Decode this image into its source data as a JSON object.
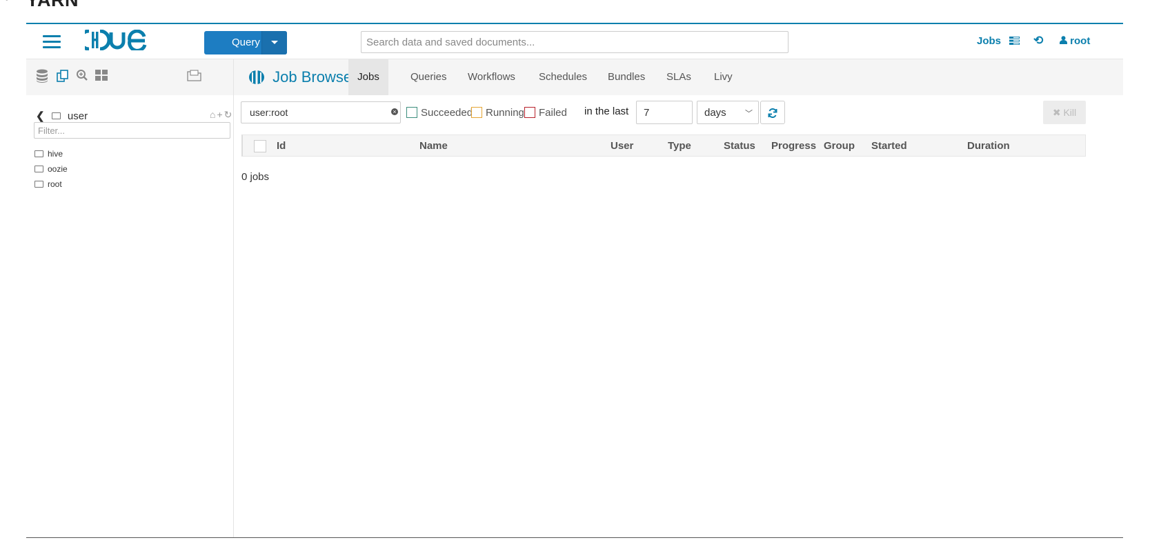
{
  "heading": {
    "bullet": "◦",
    "title": "YARN"
  },
  "topnav": {
    "query_label": "Query",
    "search_placeholder": "Search data and saved documents...",
    "jobs_label": "Jobs",
    "user_label": "root",
    "accent": "#0b7fad"
  },
  "left": {
    "breadcrumb": "user",
    "filter_placeholder": "Filter...",
    "tree": [
      "hive",
      "oozie",
      "root"
    ]
  },
  "main": {
    "title": "Job Browser",
    "tabs": [
      "Jobs",
      "Queries",
      "Workflows",
      "Schedules",
      "Bundles",
      "SLAs",
      "Livy"
    ],
    "active_tab": "Jobs",
    "filter_value": "user:root",
    "status_filters": [
      {
        "label": "Succeeded",
        "color": "#3c8d7d"
      },
      {
        "label": "Running",
        "color": "#e5a535"
      },
      {
        "label": "Failed",
        "color": "#b7202a"
      }
    ],
    "in_last_label": "in the last",
    "time_value": "7",
    "time_unit": "days",
    "kill_label": "Kill",
    "columns": [
      "Id",
      "Name",
      "User",
      "Type",
      "Status",
      "Progress",
      "Group",
      "Started",
      "Duration"
    ],
    "jobs_count": "0 jobs"
  }
}
